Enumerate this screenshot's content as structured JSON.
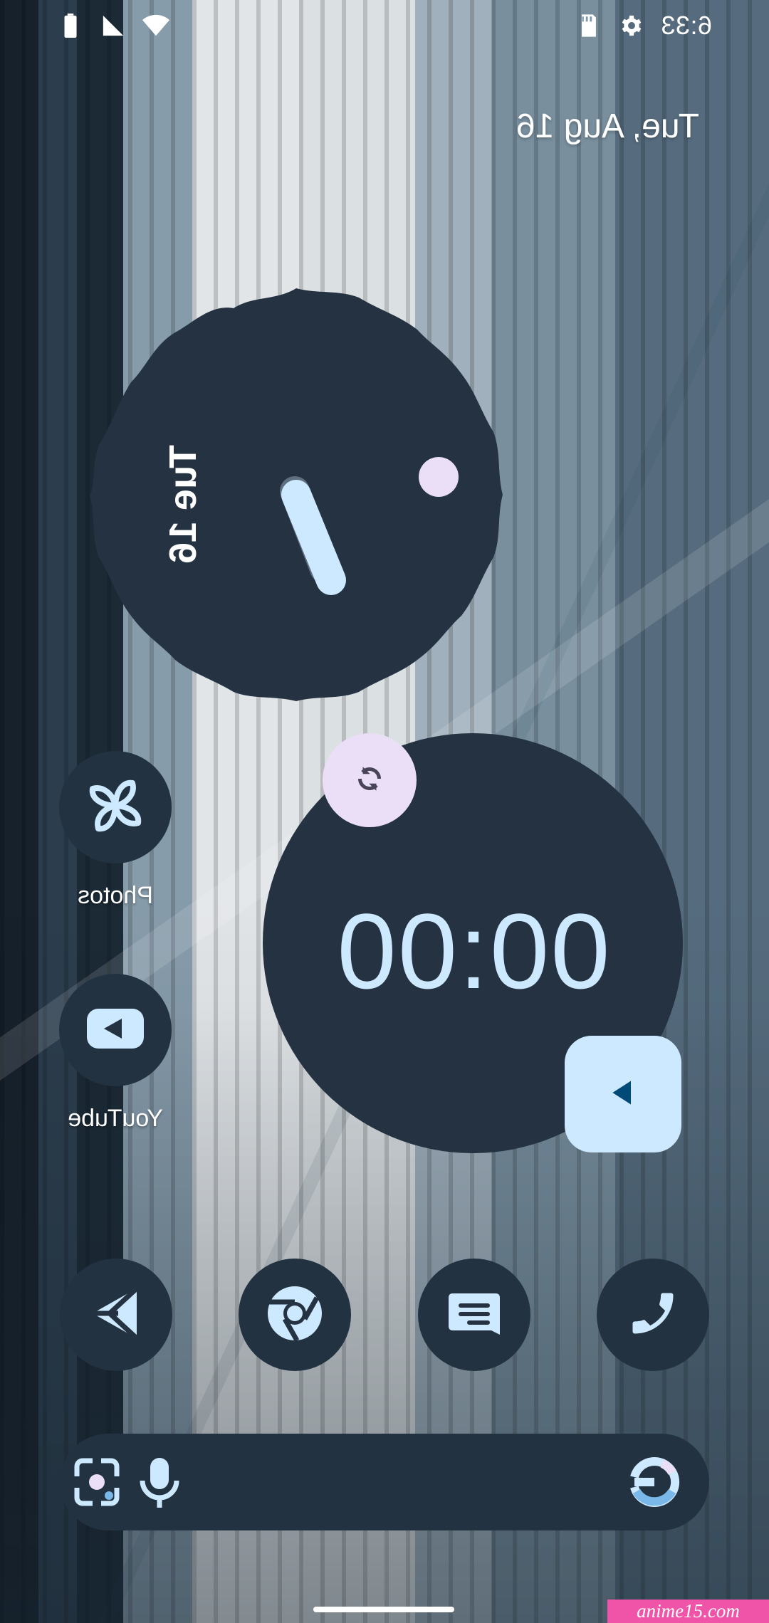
{
  "status_bar": {
    "time": "6:33",
    "icons": [
      "gear-icon",
      "sd-card-icon",
      "wifi-icon",
      "signal-icon",
      "battery-icon"
    ]
  },
  "date_widget": {
    "text": "Tue, Aug 16"
  },
  "analog_clock": {
    "date_text": "Tue 16"
  },
  "timer_widget": {
    "time": "00:00",
    "reset_icon": "refresh-icon",
    "play_icon": "play-icon"
  },
  "apps": [
    {
      "label": "Photos",
      "icon": "pinwheel-icon"
    },
    {
      "label": "YouTube",
      "icon": "youtube-icon"
    }
  ],
  "dock": [
    {
      "icon": "phone-icon"
    },
    {
      "icon": "messages-icon"
    },
    {
      "icon": "chrome-icon"
    },
    {
      "icon": "play-store-icon"
    }
  ],
  "search_bar": {
    "placeholder": "",
    "icons": [
      "google-icon",
      "microphone-icon",
      "lens-icon"
    ]
  },
  "watermark": {
    "text": "anime15.com"
  }
}
